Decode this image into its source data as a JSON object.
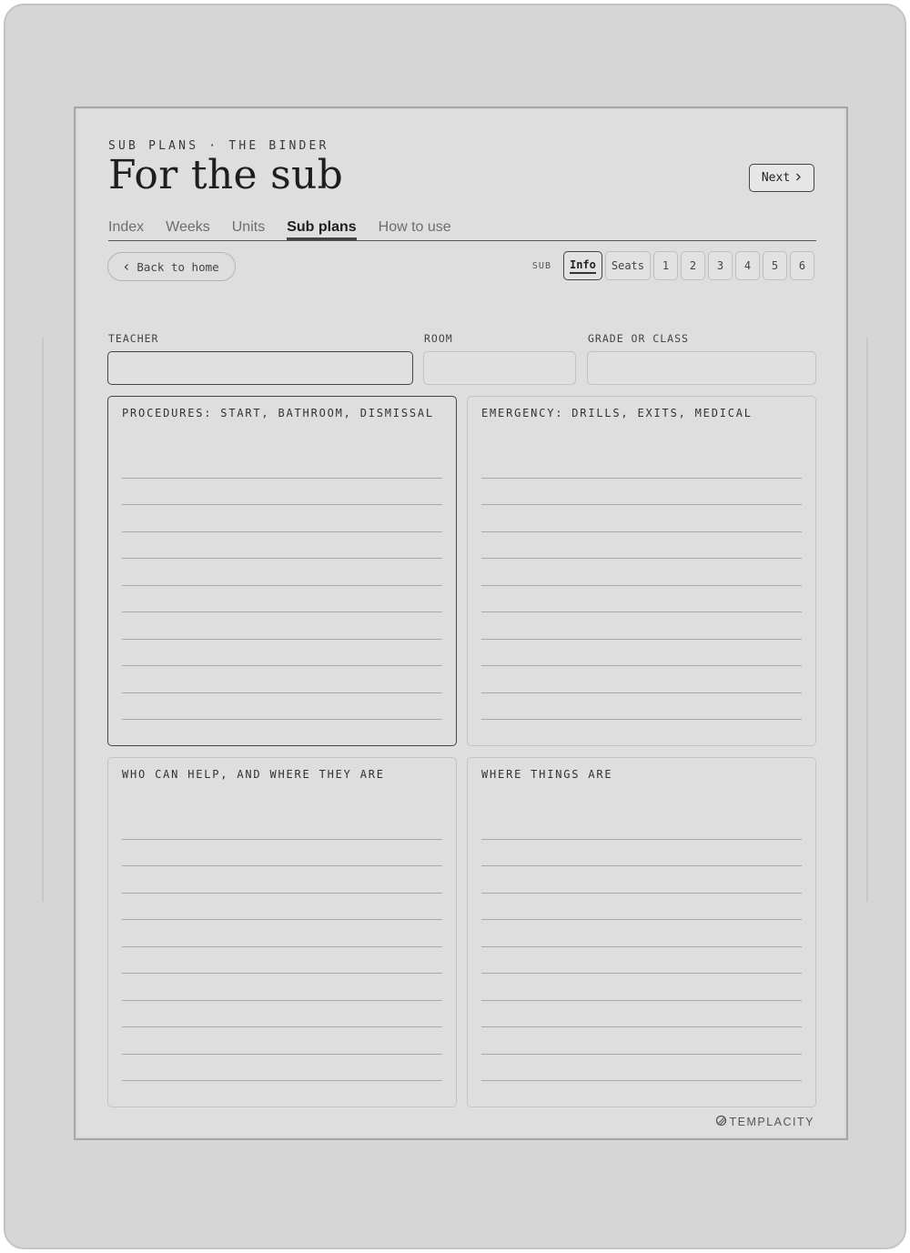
{
  "header": {
    "kicker": "SUB PLANS · THE BINDER",
    "title": "For the sub",
    "next_label": "Next",
    "next_icon": "chevron-right-icon"
  },
  "tabs": [
    {
      "label": "Index",
      "active": false
    },
    {
      "label": "Weeks",
      "active": false
    },
    {
      "label": "Units",
      "active": false
    },
    {
      "label": "Sub plans",
      "active": true
    },
    {
      "label": "How to use",
      "active": false
    }
  ],
  "back": {
    "label": "Back to home",
    "icon": "chevron-left-icon"
  },
  "pager": {
    "label": "SUB",
    "items": [
      {
        "label": "Info",
        "active": true
      },
      {
        "label": "Seats",
        "active": false
      },
      {
        "label": "1",
        "active": false
      },
      {
        "label": "2",
        "active": false
      },
      {
        "label": "3",
        "active": false
      },
      {
        "label": "4",
        "active": false
      },
      {
        "label": "5",
        "active": false
      },
      {
        "label": "6",
        "active": false
      }
    ]
  },
  "fields": {
    "teacher": {
      "label": "TEACHER",
      "value": ""
    },
    "room": {
      "label": "ROOM",
      "value": ""
    },
    "grade": {
      "label": "GRADE OR CLASS",
      "value": ""
    }
  },
  "panels": {
    "procedures": {
      "title": "PROCEDURES: START, BATHROOM, DISMISSAL"
    },
    "emergency": {
      "title": "EMERGENCY: DRILLS, EXITS, MEDICAL"
    },
    "helpers": {
      "title": "WHO CAN HELP, AND WHERE THEY ARE"
    },
    "things": {
      "title": "WHERE THINGS ARE"
    }
  },
  "footer": {
    "brand": "TEMPLACITY",
    "brand_icon": "templacity-logo-icon"
  }
}
